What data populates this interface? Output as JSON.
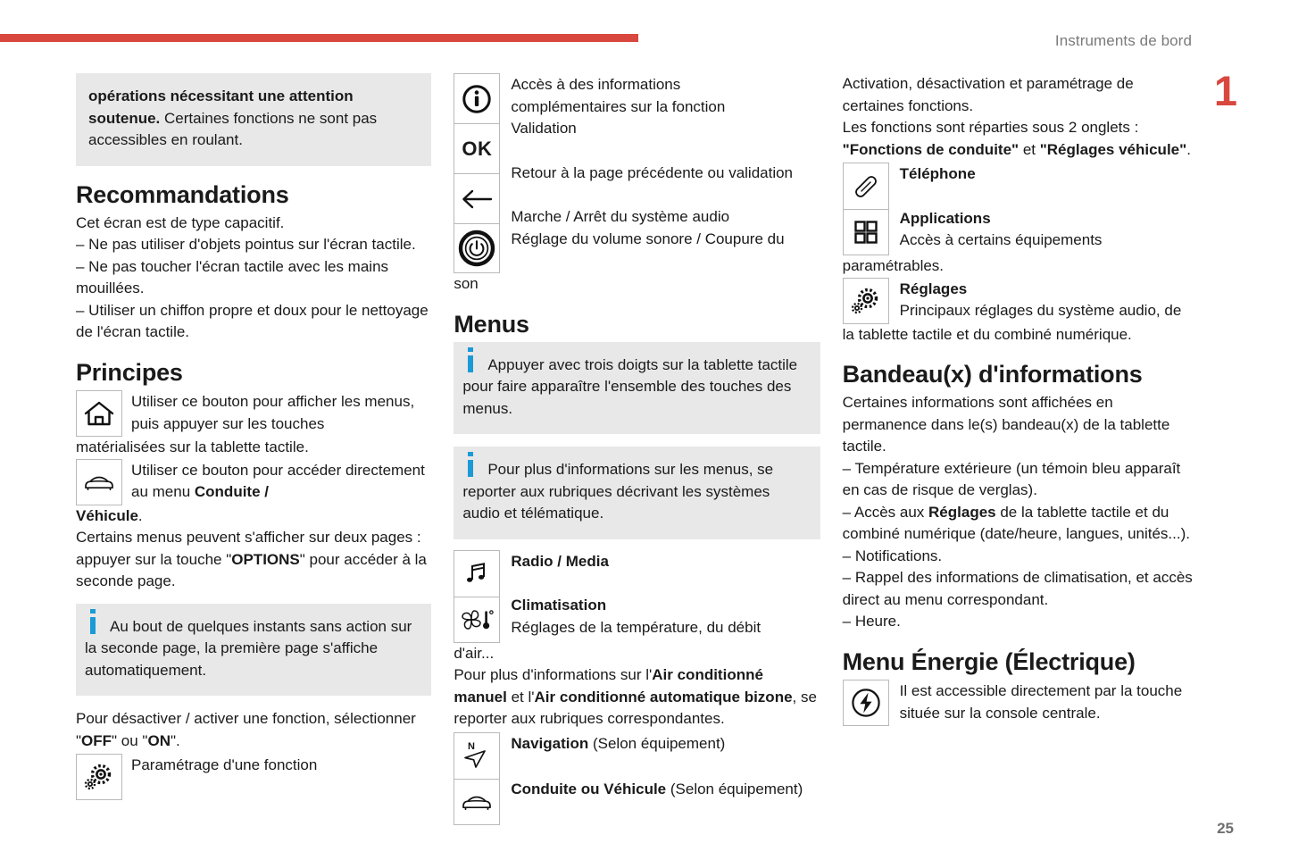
{
  "header": {
    "title": "Instruments de bord",
    "chapter": "1",
    "page": "25",
    "accent_color": "#d9483f",
    "info_color": "#1b9ad6",
    "note_bg": "#e8e8e8"
  },
  "col1": {
    "note_top": {
      "bold_line": "opérations nécessitant une attention soutenue.",
      "text": "Certaines fonctions ne sont pas accessibles en roulant."
    },
    "recommandations": {
      "heading": "Recommandations",
      "intro": "Cet écran est de type capacitif.",
      "bullets": [
        "–  Ne pas utiliser d'objets pointus sur l'écran tactile.",
        "–  Ne pas toucher l'écran tactile avec les mains mouillées.",
        "–  Utiliser un chiffon propre et doux pour le nettoyage de l'écran tactile."
      ]
    },
    "principes": {
      "heading": "Principes",
      "home_icon": "home-icon",
      "home_text_1": "Utiliser ce bouton pour afficher les menus, puis appuyer sur les touches",
      "home_text_2": "matérialisées sur la tablette tactile.",
      "car_icon": "car-icon",
      "car_text_1": "Utiliser ce bouton pour accéder directement au menu ",
      "car_text_bold": "Conduite /",
      "car_text_bold_2": "Véhicule",
      "car_text_2": ".",
      "pages_text_a": "Certains menus peuvent s'afficher sur deux pages : appuyer sur la touche \"",
      "pages_text_bold": "OPTIONS",
      "pages_text_b": "\" pour accéder à la seconde page.",
      "note": "Au bout de quelques instants sans action sur la seconde page, la première page s'affiche automatiquement.",
      "toggle_a": "Pour désactiver / activer une fonction, sélectionner \"",
      "toggle_off": "OFF",
      "toggle_mid": "\" ou \"",
      "toggle_on": "ON",
      "toggle_b": "\".",
      "gear_icon": "gear-icon",
      "gear_text": "Paramétrage d'une fonction"
    }
  },
  "col2": {
    "icons": [
      {
        "icon": "info-circle-icon",
        "lines": [
          "Accès à des informations",
          "complémentaires sur la fonction"
        ]
      },
      {
        "icon": "ok-icon",
        "label": "OK",
        "lines": [
          "Validation"
        ]
      },
      {
        "icon": "back-arrow-icon",
        "lines": [
          "Retour à la page précédente ou validation"
        ]
      },
      {
        "icon": "power-icon",
        "lines": [
          "Marche / Arrêt du système audio",
          "Réglage du volume sonore / Coupure du"
        ]
      }
    ],
    "son_overflow": "son",
    "menus": {
      "heading": "Menus",
      "note_1": "Appuyer avec trois doigts sur la tablette tactile pour faire apparaître l'ensemble des touches des menus.",
      "note_2": "Pour plus d'informations sur les menus, se reporter aux rubriques décrivant les systèmes audio et télématique."
    },
    "entries": [
      {
        "icon": "music-note-icon",
        "title": "Radio / Media",
        "desc": ""
      },
      {
        "icon": "climate-fan-icon",
        "title": "Climatisation",
        "desc": "Réglages de la température, du débit"
      }
    ],
    "dair_overflow": "d'air...",
    "aircon_a": "Pour plus d'informations sur l'",
    "aircon_b1": "Air conditionné",
    "aircon_b2": "manuel",
    "aircon_c": " et l'",
    "aircon_b3": "Air conditionné automatique bizone",
    "aircon_d": ", se reporter aux rubriques correspondantes.",
    "entries2": [
      {
        "icon": "navigation-icon",
        "title": "Navigation",
        "suffix": " (Selon équipement)"
      },
      {
        "icon": "car-icon",
        "title": "Conduite ou Véhicule",
        "suffix": " (Selon équipement)"
      }
    ]
  },
  "col3": {
    "intro_1": "Activation, désactivation et paramétrage de certaines fonctions.",
    "intro_2": "Les fonctions sont réparties sous 2 onglets :",
    "tab_1": "\"Fonctions de conduite\"",
    "tab_join": " et ",
    "tab_2": "\"Réglages véhicule\"",
    "tab_end": ".",
    "entries": [
      {
        "icon": "phone-icon",
        "title": "Téléphone",
        "desc": ""
      },
      {
        "icon": "apps-grid-icon",
        "title": "Applications",
        "desc": "Accès à certains équipements"
      }
    ],
    "param_overflow": "paramétrables.",
    "settings": {
      "icon": "gear-icon",
      "title": "Réglages",
      "desc": "Principaux réglages du système audio, de"
    },
    "settings_overflow": "la tablette tactile et du combiné numérique.",
    "bandeaux": {
      "heading": "Bandeau(x) d'informations",
      "intro": "Certaines informations sont affichées en permanence dans le(s) bandeau(x) de la tablette tactile.",
      "b1": "–  Température extérieure (un témoin bleu apparaît en cas de risque de verglas).",
      "b2_a": "–  Accès aux ",
      "b2_bold": "Réglages",
      "b2_b": " de la tablette tactile et du combiné numérique (date/heure, langues, unités...).",
      "b3": "–  Notifications.",
      "b4": "–  Rappel des informations de climatisation, et accès direct au menu correspondant.",
      "b5": "–  Heure."
    },
    "energie": {
      "heading": "Menu Énergie (Électrique)",
      "icon": "energy-bolt-icon",
      "text": "Il est accessible directement par la touche située sur la console centrale."
    }
  }
}
